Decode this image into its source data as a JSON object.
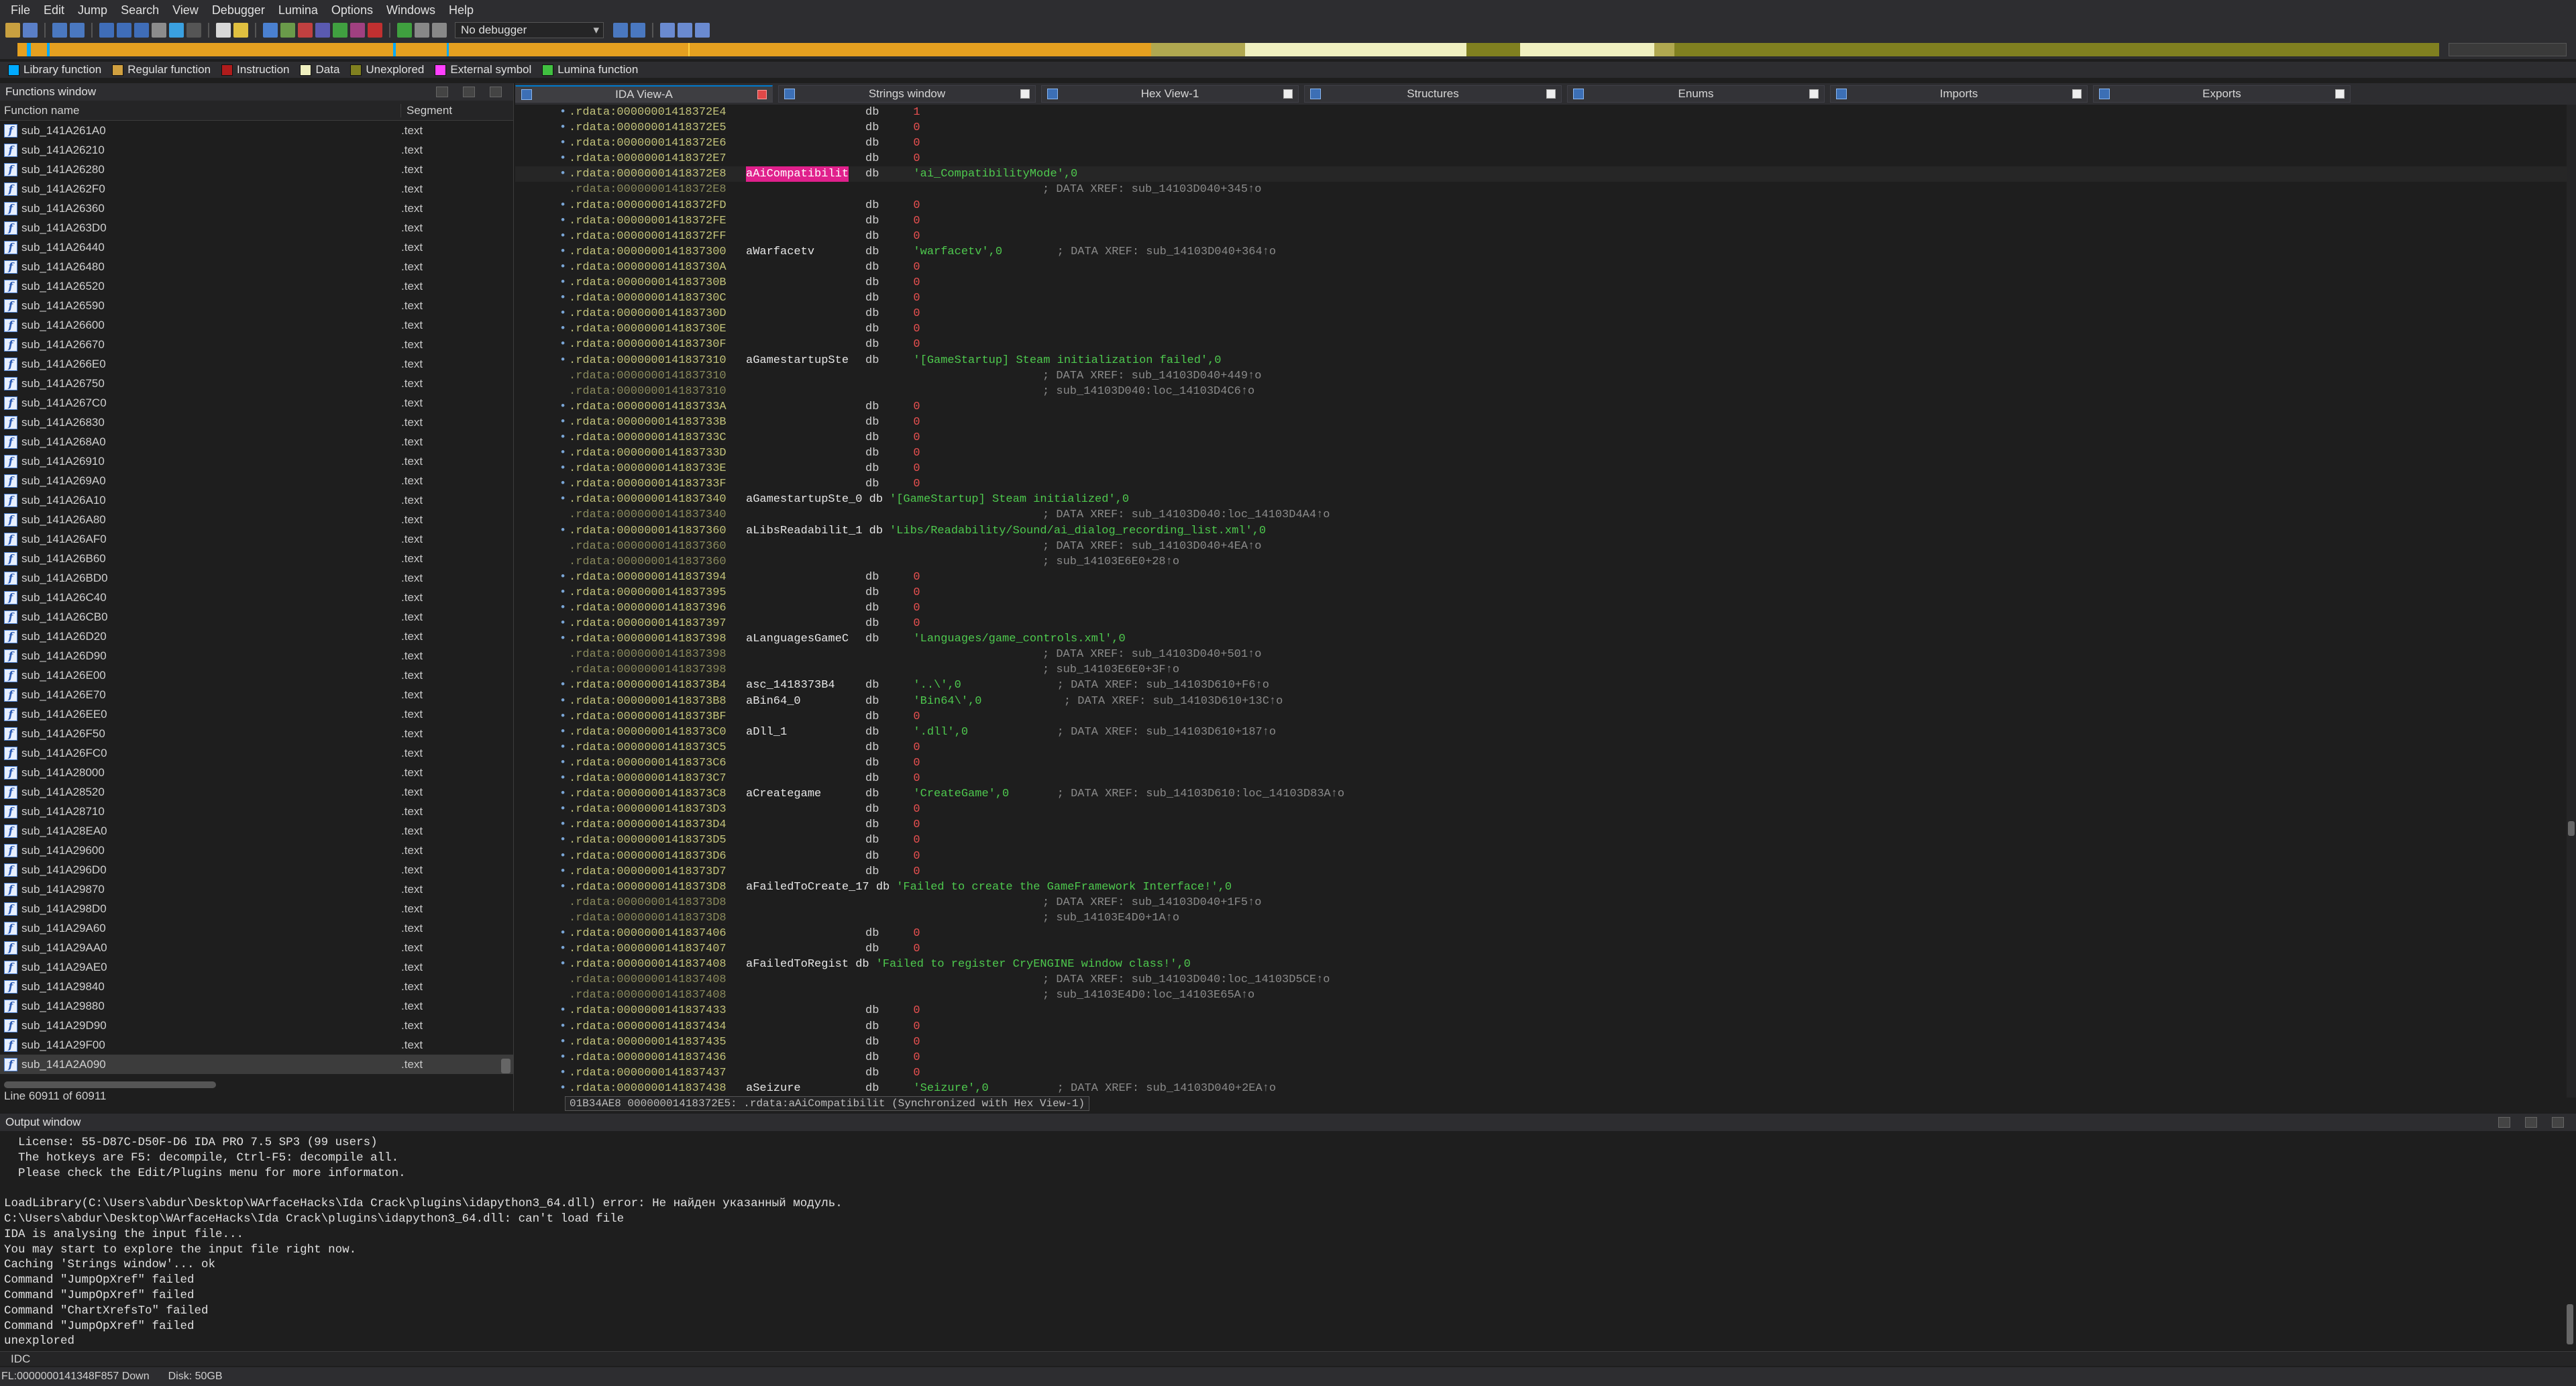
{
  "menu": [
    "File",
    "Edit",
    "Jump",
    "Search",
    "View",
    "Debugger",
    "Lumina",
    "Options",
    "Windows",
    "Help"
  ],
  "toolbar": {
    "debugger": "No debugger"
  },
  "legend": [
    {
      "label": "Library function",
      "color": "#00aaff"
    },
    {
      "label": "Regular function",
      "color": "#d0a040"
    },
    {
      "label": "Instruction",
      "color": "#b01c1c"
    },
    {
      "label": "Data",
      "color": "#f0f0c0"
    },
    {
      "label": "Unexplored",
      "color": "#808020"
    },
    {
      "label": "External symbol",
      "color": "#ff40ff"
    },
    {
      "label": "Lumina function",
      "color": "#40c040"
    }
  ],
  "functions_window": {
    "title": "Functions window",
    "col_name": "Function name",
    "col_segment": "Segment",
    "status": "Line 60911 of 60911",
    "rows": [
      [
        "sub_141A261A0",
        ".text"
      ],
      [
        "sub_141A26210",
        ".text"
      ],
      [
        "sub_141A26280",
        ".text"
      ],
      [
        "sub_141A262F0",
        ".text"
      ],
      [
        "sub_141A26360",
        ".text"
      ],
      [
        "sub_141A263D0",
        ".text"
      ],
      [
        "sub_141A26440",
        ".text"
      ],
      [
        "sub_141A26480",
        ".text"
      ],
      [
        "sub_141A26520",
        ".text"
      ],
      [
        "sub_141A26590",
        ".text"
      ],
      [
        "sub_141A26600",
        ".text"
      ],
      [
        "sub_141A26670",
        ".text"
      ],
      [
        "sub_141A266E0",
        ".text"
      ],
      [
        "sub_141A26750",
        ".text"
      ],
      [
        "sub_141A267C0",
        ".text"
      ],
      [
        "sub_141A26830",
        ".text"
      ],
      [
        "sub_141A268A0",
        ".text"
      ],
      [
        "sub_141A26910",
        ".text"
      ],
      [
        "sub_141A269A0",
        ".text"
      ],
      [
        "sub_141A26A10",
        ".text"
      ],
      [
        "sub_141A26A80",
        ".text"
      ],
      [
        "sub_141A26AF0",
        ".text"
      ],
      [
        "sub_141A26B60",
        ".text"
      ],
      [
        "sub_141A26BD0",
        ".text"
      ],
      [
        "sub_141A26C40",
        ".text"
      ],
      [
        "sub_141A26CB0",
        ".text"
      ],
      [
        "sub_141A26D20",
        ".text"
      ],
      [
        "sub_141A26D90",
        ".text"
      ],
      [
        "sub_141A26E00",
        ".text"
      ],
      [
        "sub_141A26E70",
        ".text"
      ],
      [
        "sub_141A26EE0",
        ".text"
      ],
      [
        "sub_141A26F50",
        ".text"
      ],
      [
        "sub_141A26FC0",
        ".text"
      ],
      [
        "sub_141A28000",
        ".text"
      ],
      [
        "sub_141A28520",
        ".text"
      ],
      [
        "sub_141A28710",
        ".text"
      ],
      [
        "sub_141A28EA0",
        ".text"
      ],
      [
        "sub_141A29600",
        ".text"
      ],
      [
        "sub_141A296D0",
        ".text"
      ],
      [
        "sub_141A29870",
        ".text"
      ],
      [
        "sub_141A298D0",
        ".text"
      ],
      [
        "sub_141A29A60",
        ".text"
      ],
      [
        "sub_141A29AA0",
        ".text"
      ],
      [
        "sub_141A29AE0",
        ".text"
      ],
      [
        "sub_141A29840",
        ".text"
      ],
      [
        "sub_141A29880",
        ".text"
      ],
      [
        "sub_141A29D90",
        ".text"
      ],
      [
        "sub_141A29F00",
        ".text"
      ],
      [
        "sub_141A2A090",
        ".text"
      ]
    ]
  },
  "tabs": [
    "IDA View-A",
    "Strings window",
    "Hex View-1",
    "Structures",
    "Enums",
    "Imports",
    "Exports"
  ],
  "disasm": [
    {
      "b": 1,
      "a": ".rdata:00000001418372E4",
      "l": "",
      "o": "db",
      "v": "1"
    },
    {
      "b": 1,
      "a": ".rdata:00000001418372E5",
      "l": "",
      "o": "db",
      "v": "0"
    },
    {
      "b": 1,
      "a": ".rdata:00000001418372E6",
      "l": "",
      "o": "db",
      "v": "0"
    },
    {
      "b": 1,
      "a": ".rdata:00000001418372E7",
      "l": "",
      "o": "db",
      "v": "0"
    },
    {
      "b": 1,
      "a": ".rdata:00000001418372E8",
      "l": "aAiCompatibilit",
      "pink": 1,
      "o": "db",
      "s": "'ai_CompatibilityMode',0",
      "hl": 1
    },
    {
      "b": 0,
      "a": ".rdata:00000001418372E8",
      "c": "; DATA XREF: sub_14103D040+345↑o"
    },
    {
      "b": 1,
      "a": ".rdata:00000001418372FD",
      "l": "",
      "o": "db",
      "v": "0"
    },
    {
      "b": 1,
      "a": ".rdata:00000001418372FE",
      "l": "",
      "o": "db",
      "v": "0"
    },
    {
      "b": 1,
      "a": ".rdata:00000001418372FF",
      "l": "",
      "o": "db",
      "v": "0"
    },
    {
      "b": 1,
      "a": ".rdata:0000000141837300",
      "l": "aWarfacetv",
      "o": "db",
      "s": "'warfacetv',0",
      "ci": "        ; DATA XREF: sub_14103D040+364↑o"
    },
    {
      "b": 1,
      "a": ".rdata:000000014183730A",
      "l": "",
      "o": "db",
      "v": "0"
    },
    {
      "b": 1,
      "a": ".rdata:000000014183730B",
      "l": "",
      "o": "db",
      "v": "0"
    },
    {
      "b": 1,
      "a": ".rdata:000000014183730C",
      "l": "",
      "o": "db",
      "v": "0"
    },
    {
      "b": 1,
      "a": ".rdata:000000014183730D",
      "l": "",
      "o": "db",
      "v": "0"
    },
    {
      "b": 1,
      "a": ".rdata:000000014183730E",
      "l": "",
      "o": "db",
      "v": "0"
    },
    {
      "b": 1,
      "a": ".rdata:000000014183730F",
      "l": "",
      "o": "db",
      "v": "0"
    },
    {
      "b": 1,
      "a": ".rdata:0000000141837310",
      "l": "aGamestartupSte",
      "o": "db",
      "s": "'[GameStartup] Steam initialization failed',0"
    },
    {
      "b": 0,
      "a": ".rdata:0000000141837310",
      "c": "; DATA XREF: sub_14103D040+449↑o"
    },
    {
      "b": 0,
      "a": ".rdata:0000000141837310",
      "c": "; sub_14103D040:loc_14103D4C6↑o"
    },
    {
      "b": 1,
      "a": ".rdata:000000014183733A",
      "l": "",
      "o": "db",
      "v": "0"
    },
    {
      "b": 1,
      "a": ".rdata:000000014183733B",
      "l": "",
      "o": "db",
      "v": "0"
    },
    {
      "b": 1,
      "a": ".rdata:000000014183733C",
      "l": "",
      "o": "db",
      "v": "0"
    },
    {
      "b": 1,
      "a": ".rdata:000000014183733D",
      "l": "",
      "o": "db",
      "v": "0"
    },
    {
      "b": 1,
      "a": ".rdata:000000014183733E",
      "l": "",
      "o": "db",
      "v": "0"
    },
    {
      "b": 1,
      "a": ".rdata:000000014183733F",
      "l": "",
      "o": "db",
      "v": "0"
    },
    {
      "b": 1,
      "a": ".rdata:0000000141837340",
      "l": "aGamestartupSte_0 db",
      "o": "",
      "s": "'[GameStartup] Steam initialized',0",
      "sx": 1
    },
    {
      "b": 0,
      "a": ".rdata:0000000141837340",
      "c": "; DATA XREF: sub_14103D040:loc_14103D4A4↑o"
    },
    {
      "b": 1,
      "a": ".rdata:0000000141837360",
      "l": "aLibsReadabilit_1 db",
      "o": "",
      "s": "'Libs/Readability/Sound/ai_dialog_recording_list.xml',0",
      "sx": 1
    },
    {
      "b": 0,
      "a": ".rdata:0000000141837360",
      "c": "; DATA XREF: sub_14103D040+4EA↑o"
    },
    {
      "b": 0,
      "a": ".rdata:0000000141837360",
      "c": "; sub_14103E6E0+28↑o"
    },
    {
      "b": 1,
      "a": ".rdata:0000000141837394",
      "l": "",
      "o": "db",
      "v": "0"
    },
    {
      "b": 1,
      "a": ".rdata:0000000141837395",
      "l": "",
      "o": "db",
      "v": "0"
    },
    {
      "b": 1,
      "a": ".rdata:0000000141837396",
      "l": "",
      "o": "db",
      "v": "0"
    },
    {
      "b": 1,
      "a": ".rdata:0000000141837397",
      "l": "",
      "o": "db",
      "v": "0"
    },
    {
      "b": 1,
      "a": ".rdata:0000000141837398",
      "l": "aLanguagesGameC",
      "o": "db",
      "s": "'Languages/game_controls.xml',0"
    },
    {
      "b": 0,
      "a": ".rdata:0000000141837398",
      "c": "; DATA XREF: sub_14103D040+501↑o"
    },
    {
      "b": 0,
      "a": ".rdata:0000000141837398",
      "c": "; sub_14103E6E0+3F↑o"
    },
    {
      "b": 1,
      "a": ".rdata:00000001418373B4",
      "l": "asc_1418373B4",
      "o": "db",
      "s": "'..\\',0",
      "ci": "              ; DATA XREF: sub_14103D610+F6↑o"
    },
    {
      "b": 1,
      "a": ".rdata:00000001418373B8",
      "l": "aBin64_0",
      "o": "db",
      "s": "'Bin64\\',0",
      "ci": "            ; DATA XREF: sub_14103D610+13C↑o"
    },
    {
      "b": 1,
      "a": ".rdata:00000001418373BF",
      "l": "",
      "o": "db",
      "v": "0"
    },
    {
      "b": 1,
      "a": ".rdata:00000001418373C0",
      "l": "aDll_1",
      "o": "db",
      "s": "'.dll',0",
      "ci": "             ; DATA XREF: sub_14103D610+187↑o"
    },
    {
      "b": 1,
      "a": ".rdata:00000001418373C5",
      "l": "",
      "o": "db",
      "v": "0"
    },
    {
      "b": 1,
      "a": ".rdata:00000001418373C6",
      "l": "",
      "o": "db",
      "v": "0"
    },
    {
      "b": 1,
      "a": ".rdata:00000001418373C7",
      "l": "",
      "o": "db",
      "v": "0"
    },
    {
      "b": 1,
      "a": ".rdata:00000001418373C8",
      "l": "aCreategame",
      "o": "db",
      "s": "'CreateGame',0",
      "ci": "       ; DATA XREF: sub_14103D610:loc_14103D83A↑o"
    },
    {
      "b": 1,
      "a": ".rdata:00000001418373D3",
      "l": "",
      "o": "db",
      "v": "0"
    },
    {
      "b": 1,
      "a": ".rdata:00000001418373D4",
      "l": "",
      "o": "db",
      "v": "0"
    },
    {
      "b": 1,
      "a": ".rdata:00000001418373D5",
      "l": "",
      "o": "db",
      "v": "0"
    },
    {
      "b": 1,
      "a": ".rdata:00000001418373D6",
      "l": "",
      "o": "db",
      "v": "0"
    },
    {
      "b": 1,
      "a": ".rdata:00000001418373D7",
      "l": "",
      "o": "db",
      "v": "0"
    },
    {
      "b": 1,
      "a": ".rdata:00000001418373D8",
      "l": "aFailedToCreate_17 db",
      "o": "",
      "s": "'Failed to create the GameFramework Interface!',0",
      "sx": 1
    },
    {
      "b": 0,
      "a": ".rdata:00000001418373D8",
      "c": "; DATA XREF: sub_14103D040+1F5↑o"
    },
    {
      "b": 0,
      "a": ".rdata:00000001418373D8",
      "c": "; sub_14103E4D0+1A↑o"
    },
    {
      "b": 1,
      "a": ".rdata:0000000141837406",
      "l": "",
      "o": "db",
      "v": "0"
    },
    {
      "b": 1,
      "a": ".rdata:0000000141837407",
      "l": "",
      "o": "db",
      "v": "0"
    },
    {
      "b": 1,
      "a": ".rdata:0000000141837408",
      "l": "aFailedToRegist db",
      "o": "",
      "s": "'Failed to register CryENGINE window class!',0",
      "sx": 1
    },
    {
      "b": 0,
      "a": ".rdata:0000000141837408",
      "c": "; DATA XREF: sub_14103D040:loc_14103D5CE↑o"
    },
    {
      "b": 0,
      "a": ".rdata:0000000141837408",
      "c": "; sub_14103E4D0:loc_14103E65A↑o"
    },
    {
      "b": 1,
      "a": ".rdata:0000000141837433",
      "l": "",
      "o": "db",
      "v": "0"
    },
    {
      "b": 1,
      "a": ".rdata:0000000141837434",
      "l": "",
      "o": "db",
      "v": "0"
    },
    {
      "b": 1,
      "a": ".rdata:0000000141837435",
      "l": "",
      "o": "db",
      "v": "0"
    },
    {
      "b": 1,
      "a": ".rdata:0000000141837436",
      "l": "",
      "o": "db",
      "v": "0"
    },
    {
      "b": 1,
      "a": ".rdata:0000000141837437",
      "l": "",
      "o": "db",
      "v": "0"
    },
    {
      "b": 1,
      "a": ".rdata:0000000141837438",
      "l": "aSeizure",
      "o": "db",
      "s": "'Seizure',0",
      "ci": "          ; DATA XREF: sub_14103D040+2EA↑o"
    }
  ],
  "disasm_status": "01B34AE8 00000001418372E5: .rdata:aAiCompatibilit (Synchronized with Hex View-1)",
  "output": {
    "title": "Output window",
    "text": "  License: 55-D87C-D50F-D6 IDA PRO 7.5 SP3 (99 users)\n  The hotkeys are F5: decompile, Ctrl-F5: decompile all.\n  Please check the Edit/Plugins menu for more informaton.\n\nLoadLibrary(C:\\Users\\abdur\\Desktop\\WArfaceHacks\\Ida Crack\\plugins\\idapython3_64.dll) error: Не найден указанный модуль.\nC:\\Users\\abdur\\Desktop\\WArfaceHacks\\Ida Crack\\plugins\\idapython3_64.dll: can't load file\nIDA is analysing the input file...\nYou may start to explore the input file right now.\nCaching 'Strings window'... ok\nCommand \"JumpOpXref\" failed\nCommand \"JumpOpXref\" failed\nCommand \"ChartXrefsTo\" failed\nCommand \"JumpOpXref\" failed\nunexplored",
    "idc": "IDC"
  },
  "status": {
    "addr": "FL:0000000141348F857 Down",
    "disk": "Disk: 50GB"
  }
}
